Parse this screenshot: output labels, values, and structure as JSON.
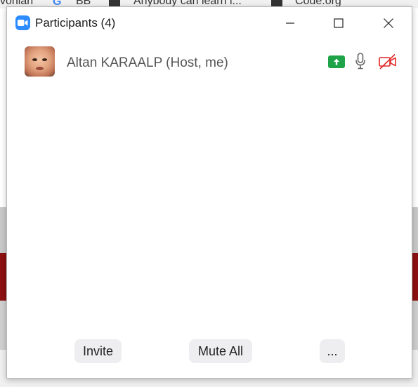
{
  "background": {
    "bookmarks": [
      {
        "label": "vohlari",
        "icon": "none"
      },
      {
        "label": "BB",
        "icon": "google-icon"
      },
      {
        "label": "Anybody can learn l...",
        "icon": "code-org-icon"
      },
      {
        "label": "Code.org",
        "icon": "code-org-icon"
      }
    ]
  },
  "window": {
    "title": "Participants (4)",
    "app_icon": "zoom-camera-icon",
    "controls": [
      "minimize-icon",
      "maximize-icon",
      "close-icon"
    ]
  },
  "participants": [
    {
      "name": "Altan KARAALP (Host, me)",
      "avatar": "avatar-photo",
      "status_icons": [
        "screen-share-icon",
        "microphone-icon",
        "video-off-icon"
      ]
    }
  ],
  "footer": {
    "invite_label": "Invite",
    "mute_all_label": "Mute All",
    "more_label": "..."
  },
  "colors": {
    "zoom_blue": "#2d8cff",
    "share_green": "#1fa348",
    "video_off_red": "#e02828"
  }
}
